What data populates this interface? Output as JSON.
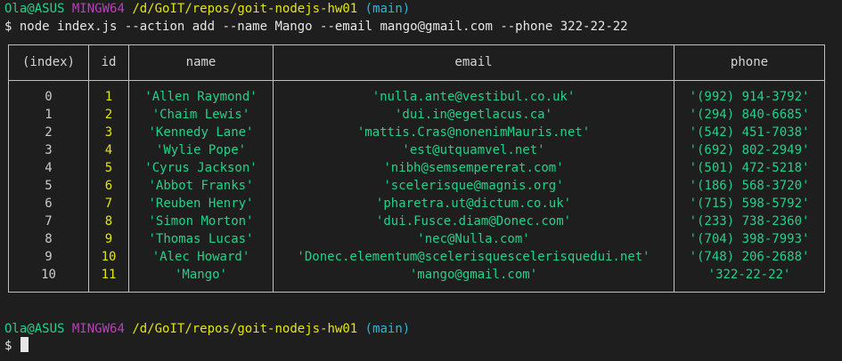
{
  "prompt": {
    "user": "Ola@ASUS",
    "shell": "MINGW64",
    "path": "/d/GoIT/repos/goit-nodejs-hw01",
    "branch": "(main)",
    "symbol": "$"
  },
  "command": "node index.js --action add --name Mango --email mango@gmail.com --phone 322-22-22",
  "table": {
    "columns": [
      "(index)",
      "id",
      "name",
      "email",
      "phone"
    ],
    "rows": [
      {
        "index": "0",
        "id": "1",
        "name": "'Allen Raymond'",
        "email": "'nulla.ante@vestibul.co.uk'",
        "phone": "'(992) 914-3792'"
      },
      {
        "index": "1",
        "id": "2",
        "name": "'Chaim Lewis'",
        "email": "'dui.in@egetlacus.ca'",
        "phone": "'(294) 840-6685'"
      },
      {
        "index": "2",
        "id": "3",
        "name": "'Kennedy Lane'",
        "email": "'mattis.Cras@nonenimMauris.net'",
        "phone": "'(542) 451-7038'"
      },
      {
        "index": "3",
        "id": "4",
        "name": "'Wylie Pope'",
        "email": "'est@utquamvel.net'",
        "phone": "'(692) 802-2949'"
      },
      {
        "index": "4",
        "id": "5",
        "name": "'Cyrus Jackson'",
        "email": "'nibh@semsempererat.com'",
        "phone": "'(501) 472-5218'"
      },
      {
        "index": "5",
        "id": "6",
        "name": "'Abbot Franks'",
        "email": "'scelerisque@magnis.org'",
        "phone": "'(186) 568-3720'"
      },
      {
        "index": "6",
        "id": "7",
        "name": "'Reuben Henry'",
        "email": "'pharetra.ut@dictum.co.uk'",
        "phone": "'(715) 598-5792'"
      },
      {
        "index": "7",
        "id": "8",
        "name": "'Simon Morton'",
        "email": "'dui.Fusce.diam@Donec.com'",
        "phone": "'(233) 738-2360'"
      },
      {
        "index": "8",
        "id": "9",
        "name": "'Thomas Lucas'",
        "email": "'nec@Nulla.com'",
        "phone": "'(704) 398-7993'"
      },
      {
        "index": "9",
        "id": "10",
        "name": "'Alec Howard'",
        "email": "'Donec.elementum@scelerisquescelerisquedui.net'",
        "phone": "'(748) 206-2688'"
      },
      {
        "index": "10",
        "id": "11",
        "name": "'Mango'",
        "email": "'mango@gmail.com'",
        "phone": "'322-22-22'"
      }
    ]
  },
  "colors": {
    "background": "#1e1e1e",
    "user": "#23d18b",
    "shell": "#bc3fbc",
    "path": "#e5e510",
    "branch": "#29b8db",
    "id_values": "#e5e510",
    "string_values": "#23d18b",
    "border": "#bfbfbf"
  }
}
